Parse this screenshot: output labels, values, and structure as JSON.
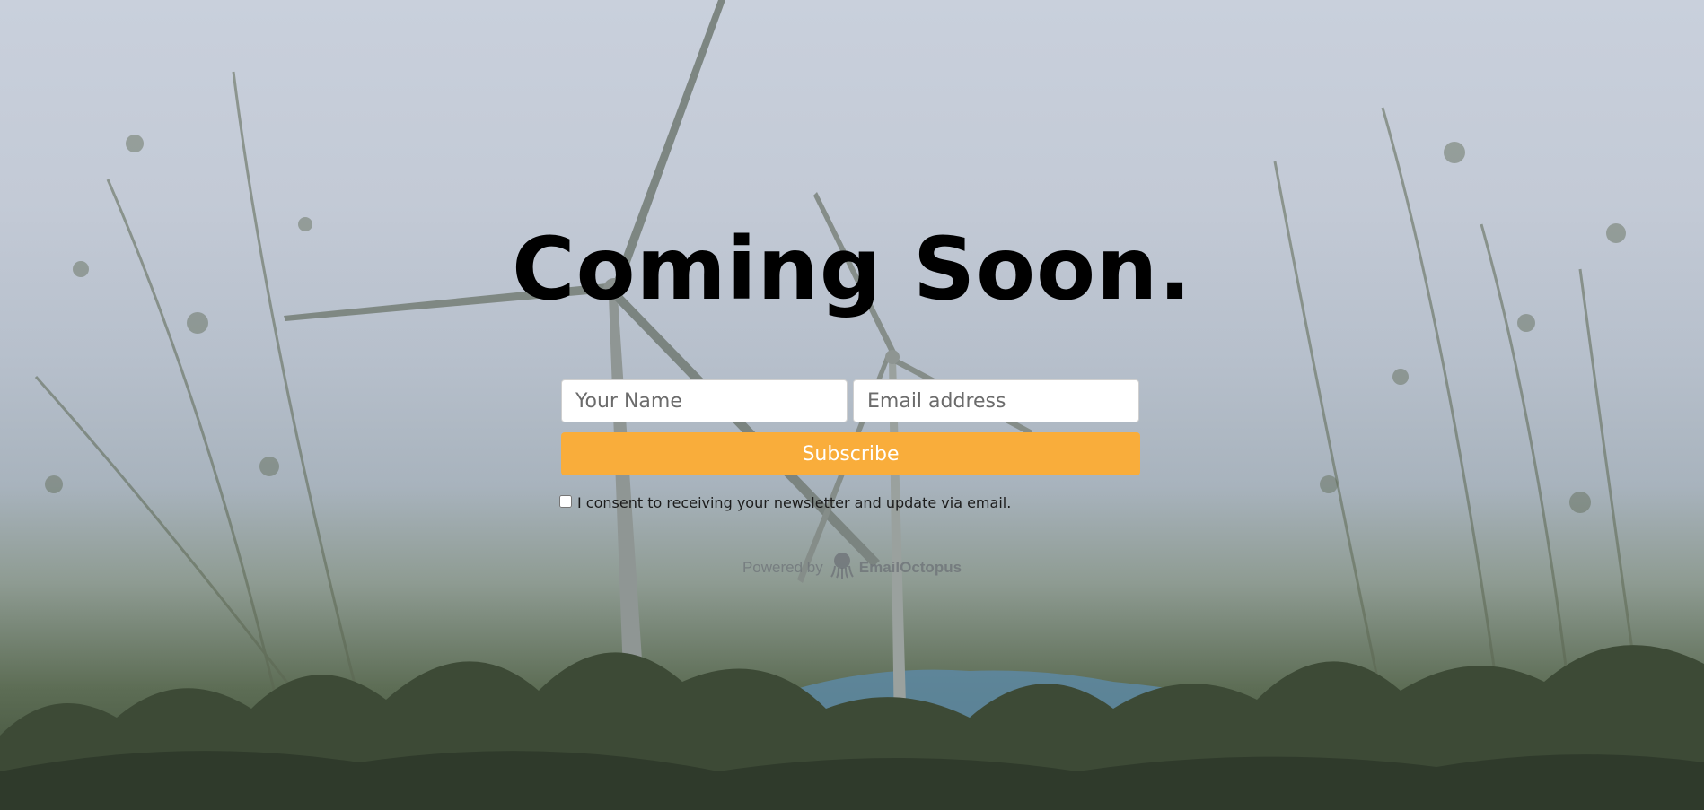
{
  "page": {
    "title": "Coming Soon."
  },
  "form": {
    "name_placeholder": "Your Name",
    "email_placeholder": "Email address",
    "subscribe_label": "Subscribe",
    "consent_label": "I consent to receiving your newsletter and update via email.",
    "consent_checked": false
  },
  "footer": {
    "powered_by": "Powered by",
    "brand_name": "EmailOctopus",
    "brand_icon": "octopus-icon"
  },
  "colors": {
    "accent": "#f9ad3b",
    "title": "#000000",
    "input_bg": "#ffffff"
  }
}
